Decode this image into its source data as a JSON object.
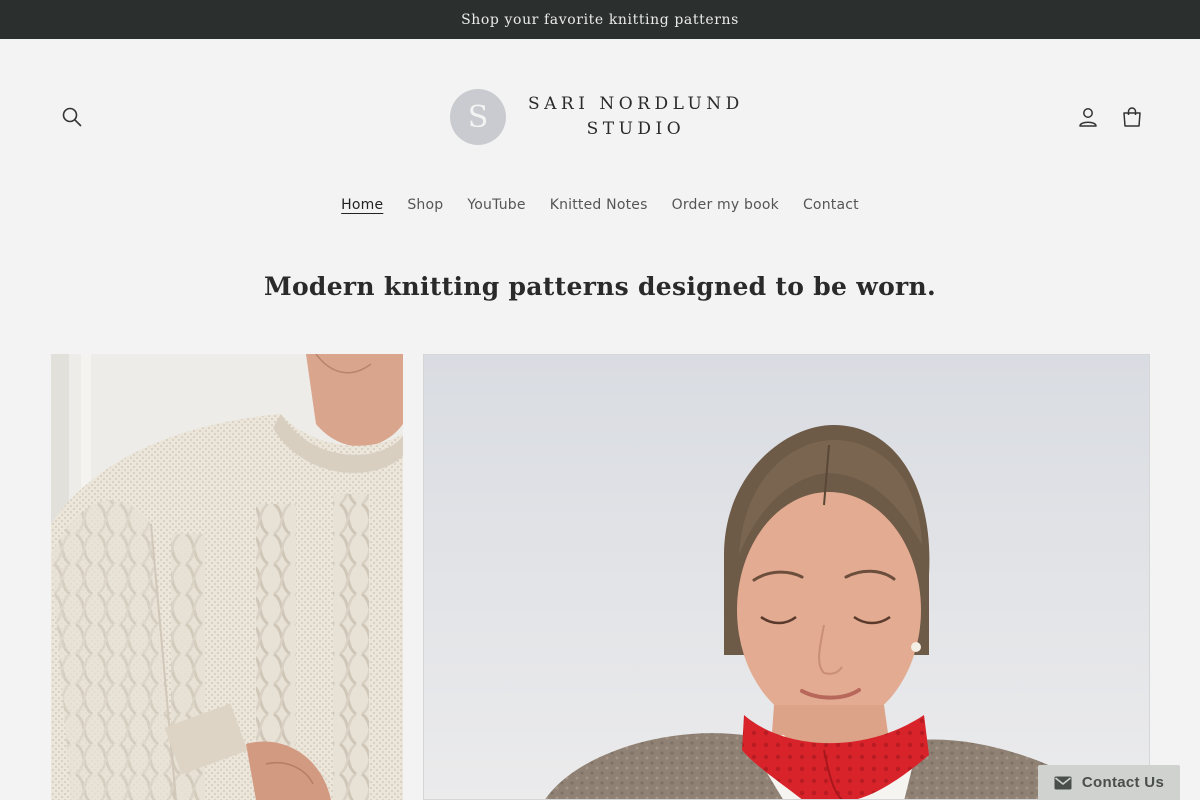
{
  "announcement": {
    "text": "Shop your favorite knitting patterns"
  },
  "logo": {
    "mark_letter": "S",
    "line1": "SARI NORDLUND",
    "line2": "STUDIO"
  },
  "header": {
    "search_icon": "search-icon",
    "account_icon": "account-icon",
    "cart_icon": "cart-icon"
  },
  "nav": {
    "items": [
      {
        "label": "Home",
        "active": true
      },
      {
        "label": "Shop"
      },
      {
        "label": "YouTube"
      },
      {
        "label": "Knitted Notes"
      },
      {
        "label": "Order my book"
      },
      {
        "label": "Contact"
      }
    ]
  },
  "main": {
    "headline": "Modern knitting patterns designed to be worn."
  },
  "images": {
    "left": {
      "subject": "woman wearing cream cable-knit sweater"
    },
    "right": {
      "subject": "woman wearing taupe cardigan and red knitted scarf"
    }
  },
  "chat": {
    "label": "Contact Us",
    "icon": "envelope-icon"
  },
  "colors": {
    "announcement_bg": "#2b302e",
    "page_bg": "#f3f3f3",
    "scarf_red": "#d8232a",
    "sweater_cream": "#e9e2d7"
  }
}
